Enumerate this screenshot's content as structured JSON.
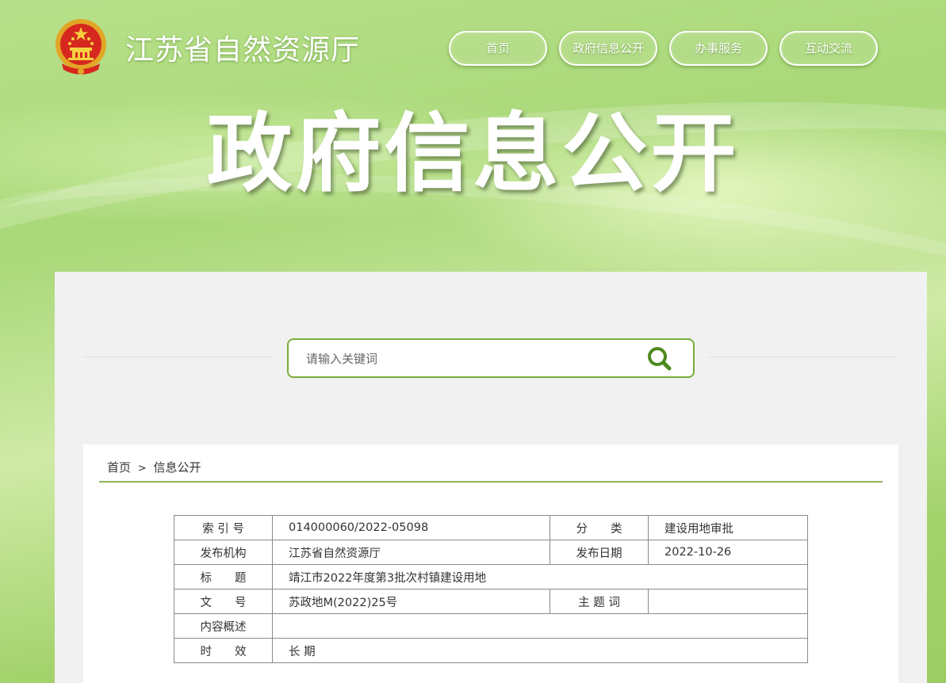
{
  "header": {
    "site_title": "江苏省自然资源厅",
    "nav": [
      "首页",
      "政府信息公开",
      "办事服务",
      "互动交流"
    ],
    "banner_title": "政府信息公开"
  },
  "search": {
    "placeholder": "请输入关键词"
  },
  "breadcrumb": {
    "home": "首页",
    "separator": ">",
    "current": "信息公开"
  },
  "meta": {
    "index_label": "索 引 号",
    "index_value": "014000060/2022-05098",
    "category_label": "分　　类",
    "category_value": "建设用地审批",
    "publisher_label": "发布机构",
    "publisher_value": "江苏省自然资源厅",
    "date_label": "发布日期",
    "date_value": "2022-10-26",
    "title_label": "标　　题",
    "title_value": "靖江市2022年度第3批次村镇建设用地",
    "docno_label": "文　　号",
    "docno_value": "苏政地M(2022)25号",
    "subject_label": "主 题 词",
    "subject_value": "",
    "summary_label": "内容概述",
    "summary_value": "",
    "validity_label": "时　　效",
    "validity_value": "长 期"
  },
  "colors": {
    "accent_green": "#7aac3a",
    "rule_green": "#8cb558",
    "panel_bg": "#f1f1f1"
  },
  "icons": {
    "emblem": "national-emblem-icon",
    "search": "search-icon"
  }
}
